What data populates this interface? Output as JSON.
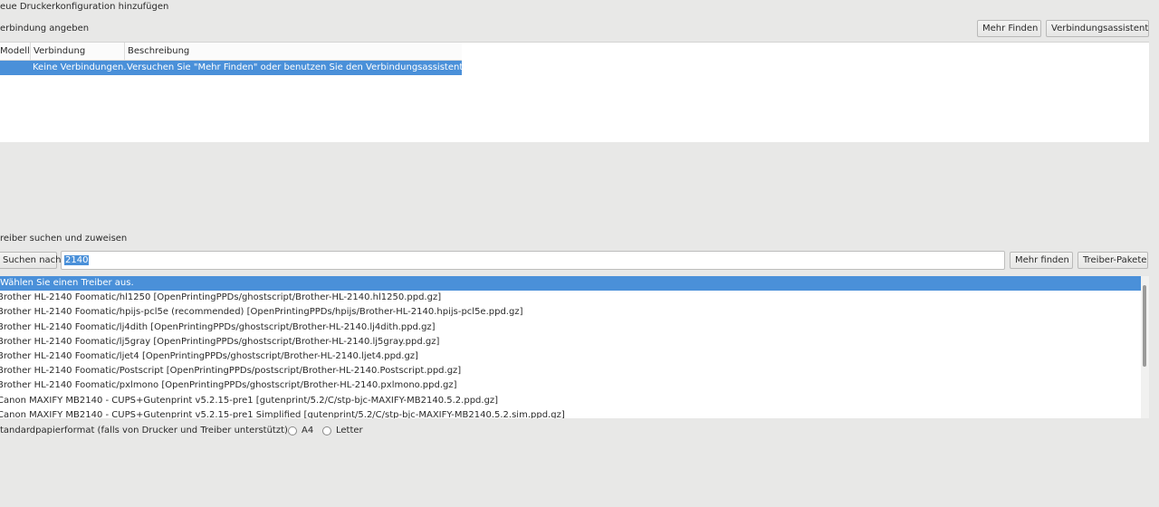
{
  "title": "eue Druckerkonfiguration hinzufügen",
  "connection": {
    "label": "erbindung angeben",
    "find_more_button": "Mehr Finden",
    "wizard_button": "Verbindungsassistent",
    "columns": [
      "Modell",
      "Verbindung",
      "Beschreibung"
    ],
    "row": {
      "connection": "Keine Verbindungen.",
      "description": "Versuchen Sie \"Mehr Finden\" oder benutzen Sie den Verbindungsassistenten."
    }
  },
  "driver": {
    "label": "reiber suchen und zuweisen",
    "search_button": "Suchen nach",
    "search_value": "2140",
    "find_more_button": "Mehr finden",
    "packages_button": "Treiber-Pakete",
    "items": [
      "Wählen Sie einen Treiber aus.",
      "Brother HL-2140 Foomatic/hl1250 [OpenPrintingPPDs/ghostscript/Brother-HL-2140.hl1250.ppd.gz]",
      "Brother HL-2140 Foomatic/hpijs-pcl5e (recommended) [OpenPrintingPPDs/hpijs/Brother-HL-2140.hpijs-pcl5e.ppd.gz]",
      "Brother HL-2140 Foomatic/lj4dith [OpenPrintingPPDs/ghostscript/Brother-HL-2140.lj4dith.ppd.gz]",
      "Brother HL-2140 Foomatic/lj5gray [OpenPrintingPPDs/ghostscript/Brother-HL-2140.lj5gray.ppd.gz]",
      "Brother HL-2140 Foomatic/ljet4 [OpenPrintingPPDs/ghostscript/Brother-HL-2140.ljet4.ppd.gz]",
      "Brother HL-2140 Foomatic/Postscript [OpenPrintingPPDs/postscript/Brother-HL-2140.Postscript.ppd.gz]",
      "Brother HL-2140 Foomatic/pxlmono [OpenPrintingPPDs/ghostscript/Brother-HL-2140.pxlmono.ppd.gz]",
      "Canon MAXIFY MB2140 - CUPS+Gutenprint v5.2.15-pre1 [gutenprint/5.2/C/stp-bjc-MAXIFY-MB2140.5.2.ppd.gz]",
      "Canon MAXIFY MB2140 - CUPS+Gutenprint v5.2.15-pre1 Simplified [gutenprint/5.2/C/stp-bjc-MAXIFY-MB2140.5.2.sim.ppd.gz]"
    ]
  },
  "paper": {
    "label": "tandardpapierformat (falls von Drucker und Treiber unterstützt)",
    "options": [
      "A4",
      "Letter"
    ]
  }
}
